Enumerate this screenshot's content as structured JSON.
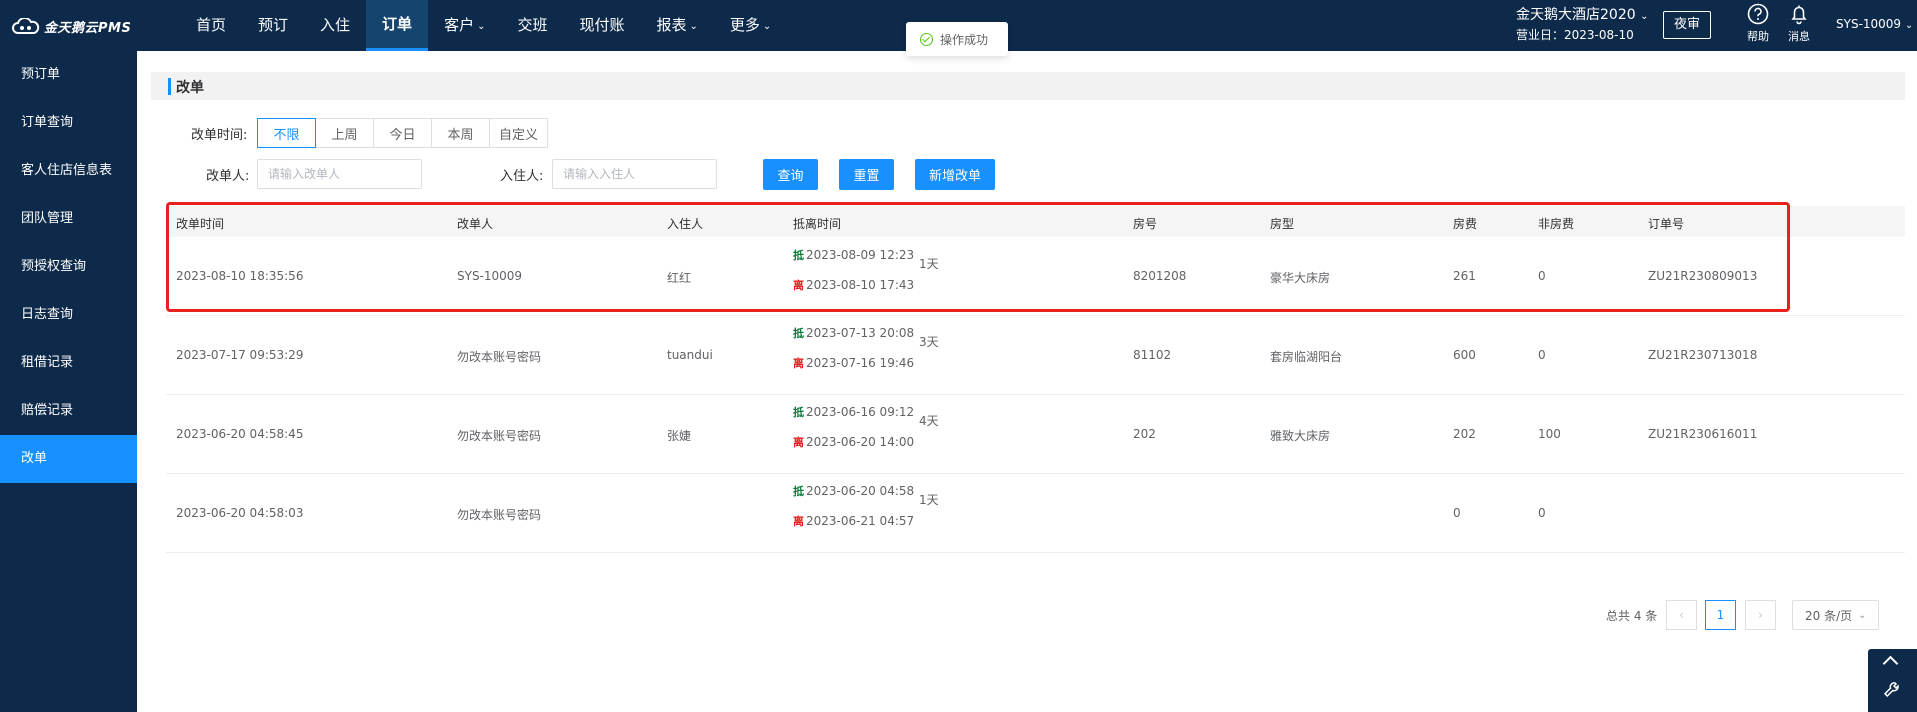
{
  "app": {
    "logo_text": "金天鹅云PMS"
  },
  "nav": {
    "items": [
      {
        "label": "首页",
        "dropdown": false
      },
      {
        "label": "预订",
        "dropdown": false
      },
      {
        "label": "入住",
        "dropdown": false
      },
      {
        "label": "订单",
        "dropdown": false,
        "active": true
      },
      {
        "label": "客户",
        "dropdown": true
      },
      {
        "label": "交班",
        "dropdown": false
      },
      {
        "label": "现付账",
        "dropdown": false
      },
      {
        "label": "报表",
        "dropdown": true
      },
      {
        "label": "更多",
        "dropdown": true
      }
    ]
  },
  "header": {
    "hotel_name": "金天鹅大酒店2020",
    "business_date": "营业日：2023-08-10",
    "night_audit": "夜审",
    "help": "帮助",
    "messages": "消息",
    "user": "SYS-10009"
  },
  "toast": {
    "text": "操作成功"
  },
  "sidebar": {
    "items": [
      {
        "label": "预订单"
      },
      {
        "label": "订单查询"
      },
      {
        "label": "客人住店信息表"
      },
      {
        "label": "团队管理"
      },
      {
        "label": "预授权查询"
      },
      {
        "label": "日志查询"
      },
      {
        "label": "租借记录"
      },
      {
        "label": "赔偿记录"
      },
      {
        "label": "改单",
        "active": true
      }
    ]
  },
  "page": {
    "title": "改单",
    "filters": {
      "time_label": "改单时间:",
      "time_options": [
        "不限",
        "上周",
        "今日",
        "本周",
        "自定义"
      ],
      "time_selected": "不限",
      "modifier_label": "改单人:",
      "modifier_placeholder": "请输入改单人",
      "guest_label": "入住人:",
      "guest_placeholder": "请输入入住人"
    },
    "buttons": {
      "query": "查询",
      "reset": "重置",
      "add": "新增改单"
    }
  },
  "table": {
    "columns": [
      "改单时间",
      "改单人",
      "入住人",
      "抵离时间",
      "房号",
      "房型",
      "房费",
      "非房费",
      "订单号"
    ],
    "arrive_tag": "抵",
    "depart_tag": "离",
    "rows": [
      {
        "time": "2023-08-10 18:35:56",
        "modifier": "SYS-10009",
        "guest": "红红",
        "arrive": "2023-08-09 12:23",
        "depart": "2023-08-10 17:43",
        "days": "1天",
        "room": "8201208",
        "room_type": "豪华大床房",
        "room_fee": "261",
        "other_fee": "0",
        "order_no": "ZU21R230809013"
      },
      {
        "time": "2023-07-17 09:53:29",
        "modifier": "勿改本账号密码",
        "guest": "tuandui",
        "arrive": "2023-07-13 20:08",
        "depart": "2023-07-16 19:46",
        "days": "3天",
        "room": "81102",
        "room_type": "套房临湖阳台",
        "room_fee": "600",
        "other_fee": "0",
        "order_no": "ZU21R230713018"
      },
      {
        "time": "2023-06-20 04:58:45",
        "modifier": "勿改本账号密码",
        "guest": "张婕",
        "arrive": "2023-06-16 09:12",
        "depart": "2023-06-20 14:00",
        "days": "4天",
        "room": "202",
        "room_type": "雅致大床房",
        "room_fee": "202",
        "other_fee": "100",
        "order_no": "ZU21R230616011"
      },
      {
        "time": "2023-06-20 04:58:03",
        "modifier": "勿改本账号密码",
        "guest": "",
        "arrive": "2023-06-20 04:58",
        "depart": "2023-06-21 04:57",
        "days": "1天",
        "room": "",
        "room_type": "",
        "room_fee": "0",
        "other_fee": "0",
        "order_no": ""
      }
    ]
  },
  "pagination": {
    "total": "总共 4 条",
    "current_page": "1",
    "page_size": "20 条/页"
  },
  "colors": {
    "nav_bg": "#0e2a4a",
    "accent": "#1890ff",
    "highlight_border": "#e8201e",
    "arrive_tag": "#0b7a3b",
    "depart_tag": "#e0201e"
  }
}
